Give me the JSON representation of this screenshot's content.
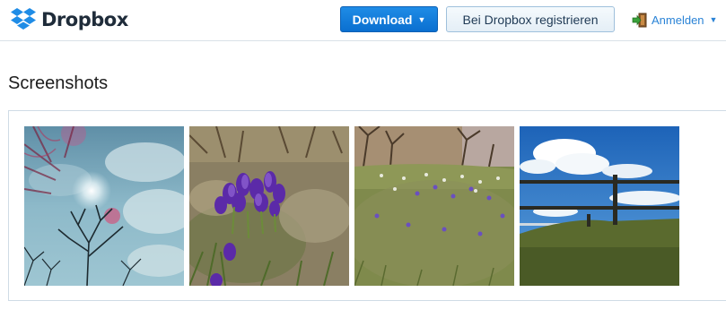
{
  "header": {
    "logo_text": "Dropbox",
    "download_label": "Download",
    "register_label": "Bei Dropbox registrieren",
    "login_label": "Anmelden"
  },
  "icons": {
    "logo": "dropbox-logo-icon",
    "download_caret": "caret-down-icon",
    "login": "login-door-icon",
    "login_caret": "caret-down-icon"
  },
  "colors": {
    "brand_blue": "#1f8ce6",
    "link_blue": "#2a83d6",
    "logo_text": "#1f2c3a"
  },
  "section": {
    "title": "Screenshots"
  },
  "photos": [
    {
      "name": "photo-sky-tree"
    },
    {
      "name": "photo-crocus-cluster"
    },
    {
      "name": "photo-crocus-meadow"
    },
    {
      "name": "photo-fence-sky"
    }
  ]
}
